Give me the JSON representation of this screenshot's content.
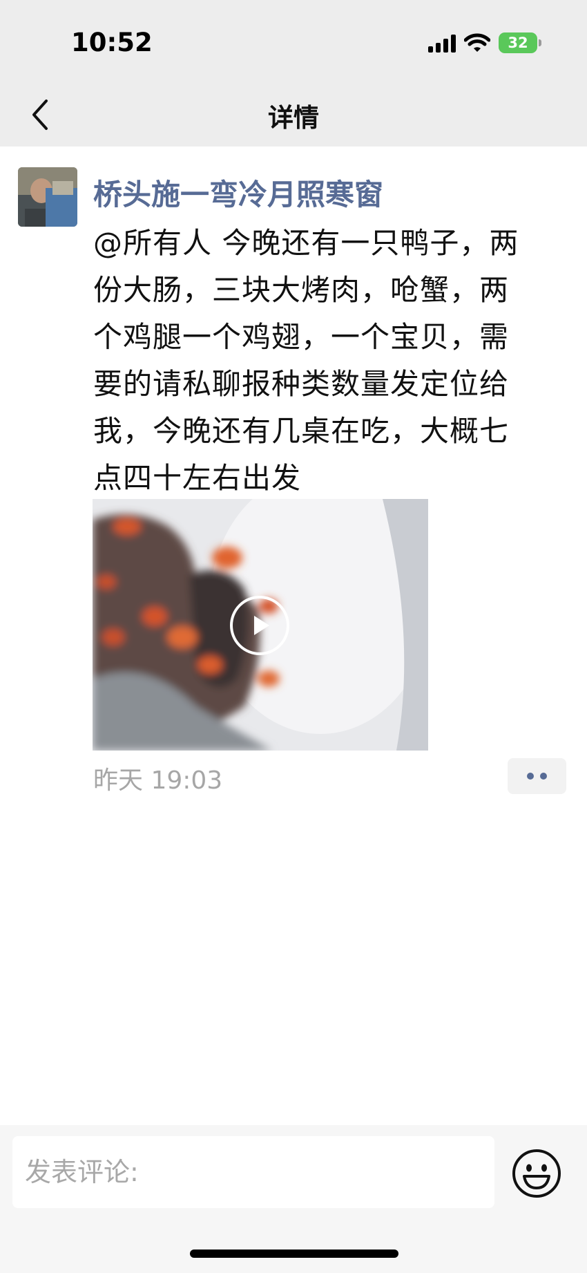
{
  "status_bar": {
    "time": "10:52",
    "battery": "32",
    "icons": [
      "signal-icon",
      "wifi-icon",
      "battery-charging-icon"
    ]
  },
  "nav": {
    "title": "详情",
    "back_icon": "chevron-left-icon"
  },
  "post": {
    "author": "桥头施一弯冷月照寒窗",
    "text_lines": [
      "@所有人 今晚还有一只鸭子，两",
      "份大肠，三块大烤肉，呛蟹，两",
      "个鸡腿一个鸡翅，一个宝贝，需",
      "要的请私聊报种类数量发定位给",
      "我，今晚还有几桌在吃，大概七",
      "点四十左右出发"
    ],
    "time": "昨天 19:03",
    "video_icon": "play-icon",
    "more_icon": "more-dots-icon"
  },
  "comment_bar": {
    "placeholder": "发表评论:",
    "value": "",
    "emoji_icon": "smiley-icon"
  },
  "colors": {
    "accent": "#576b95",
    "header_bg": "#ededed",
    "battery": "#5ac85a"
  }
}
